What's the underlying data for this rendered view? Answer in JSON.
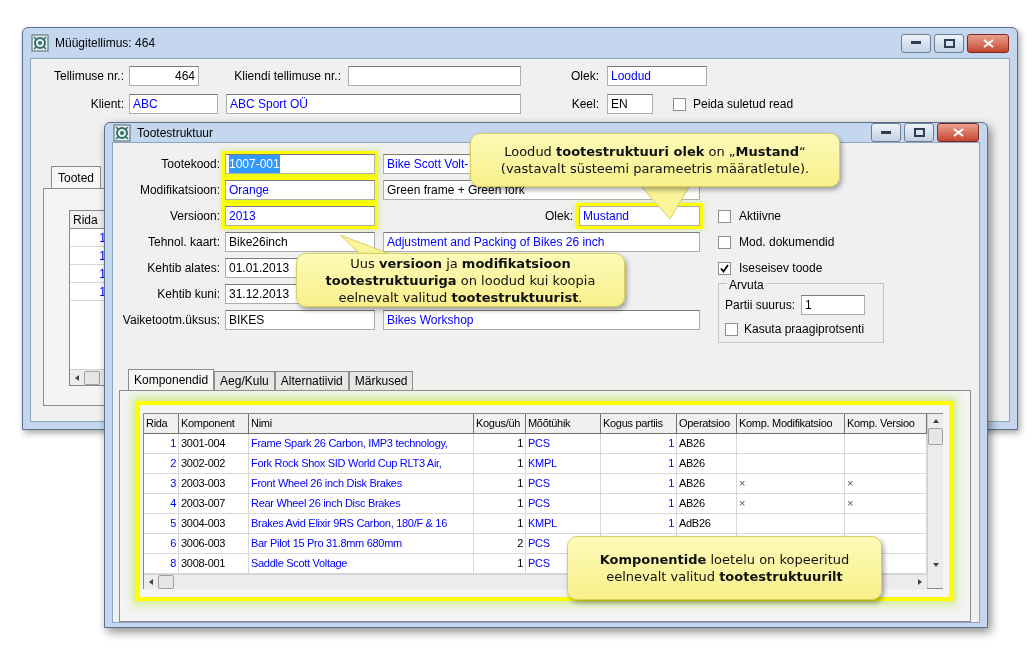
{
  "back_window": {
    "title": "Müügitellimus: 464",
    "row1": [
      {
        "label": "Tellimuse nr.:",
        "value": "464",
        "kind": "number"
      },
      {
        "label": "Kliendi tellimuse nr.:"
      },
      {
        "label": "Olek:",
        "value": "Loodud",
        "kind": "link"
      }
    ],
    "row2": [
      {
        "label": "Klient:",
        "value": "ABC",
        "kind": "link"
      },
      {
        "value": "ABC Sport OÜ",
        "kind": "link"
      },
      {
        "label": "Keel:",
        "value": "EN",
        "kind": "plain"
      }
    ],
    "checkbox": {
      "label": "Peida suletud read",
      "checked": false
    },
    "tabs": [
      {
        "label": "Tooted",
        "selected": true
      }
    ],
    "table": {
      "columns": [
        "Rida"
      ],
      "rows": [
        "1",
        "1",
        "1",
        "1"
      ]
    }
  },
  "child_window": {
    "title": "Tootestruktuur",
    "fields": [
      {
        "label": "Tootekood:",
        "value": "1007-001",
        "kind": "link",
        "highlighted": true,
        "text_selected": true,
        "description": {
          "value": "Bike Scott Volt-",
          "kind": "link"
        }
      },
      {
        "label": "Modifikatsioon:",
        "value": "Orange",
        "kind": "link",
        "highlighted": true,
        "text_selected": false,
        "description": {
          "value": "Green frame + Green fork",
          "kind": "plain"
        }
      },
      {
        "label": "Versioon:",
        "value": "2013",
        "kind": "link",
        "highlighted": true,
        "text_selected": false
      },
      {
        "label": "Tehnol. kaart:",
        "value": "Bike26inch",
        "kind": "plain",
        "highlighted": false,
        "text_selected": false,
        "description": {
          "value": "Adjustment and Packing of Bikes 26 inch",
          "kind": "link"
        }
      },
      {
        "label": "Kehtib alates:",
        "value": "01.01.2013",
        "kind": "plain",
        "highlighted": false,
        "text_selected": false
      },
      {
        "label": "Kehtib kuni:",
        "value": "31.12.2013",
        "kind": "plain",
        "highlighted": false,
        "text_selected": false
      },
      {
        "label": "Vaiketootm.üksus:",
        "value": "BIKES",
        "kind": "plain",
        "highlighted": false,
        "text_selected": false,
        "description": {
          "value": "Bikes Workshop",
          "kind": "link"
        }
      }
    ],
    "status": {
      "label": "Olek:",
      "value": "Mustand",
      "kind": "link",
      "highlighted": true
    },
    "checkboxes": [
      {
        "label": "Aktiivne",
        "checked": false
      },
      {
        "label": "Mod. dokumendid",
        "checked": false
      },
      {
        "label": "Iseseisev toode",
        "checked": true
      }
    ],
    "group": {
      "title": "Arvuta",
      "field": {
        "label": "Partii suurus:",
        "value": "1"
      },
      "checkbox": {
        "label": "Kasuta praagiprotsenti",
        "checked": false
      }
    },
    "tabs": [
      {
        "label": "Komponendid",
        "selected": true
      },
      {
        "label": "Aeg/Kulu",
        "selected": false
      },
      {
        "label": "Alternatiivid",
        "selected": false
      },
      {
        "label": "Märkused",
        "selected": false
      }
    ],
    "table": {
      "columns": [
        {
          "title": "Rida",
          "kind": "link_number"
        },
        {
          "title": "Komponent",
          "kind": "plain"
        },
        {
          "title": "Nimi",
          "kind": "link"
        },
        {
          "title": "Kogus/üh",
          "kind": "number"
        },
        {
          "title": "Mõõtühik",
          "kind": "link"
        },
        {
          "title": "Kogus partiis",
          "kind": "link_number"
        },
        {
          "title": "Operatsioo",
          "kind": "plain"
        },
        {
          "title": "Komp. Modifikatsioo",
          "kind": "mark"
        },
        {
          "title": "Komp. Versioo",
          "kind": "mark"
        }
      ],
      "rows": [
        [
          "1",
          "3001-004",
          "Frame Spark 26 Carbon, IMP3 technology,",
          "1",
          "PCS",
          "1",
          "AB26",
          null,
          null
        ],
        [
          "2",
          "3002-002",
          "Fork Rock Shox SID World Cup RLT3 Air,",
          "1",
          "KMPL",
          "1",
          "AB26",
          null,
          null
        ],
        [
          "3",
          "2003-003",
          "Front Wheel 26 inch Disk Brakes",
          "1",
          "PCS",
          "1",
          "AB26",
          "×",
          "×"
        ],
        [
          "4",
          "2003-007",
          "Rear Wheel 26 inch Disc Brakes",
          "1",
          "PCS",
          "1",
          "AB26",
          "×",
          "×"
        ],
        [
          "5",
          "3004-003",
          "Brakes Avid Elixir 9RS Carbon, 180/F & 16",
          "1",
          "KMPL",
          "1",
          "AdB26",
          null,
          null
        ],
        [
          "6",
          "3006-003",
          "Bar Pilot 15 Pro 31.8mm 680mm",
          "2",
          "PCS",
          null,
          null,
          null,
          null
        ],
        [
          "8",
          "3008-001",
          "Saddle Scott Voltage",
          "1",
          "PCS",
          null,
          null,
          null,
          null
        ]
      ]
    }
  },
  "callouts": [
    {
      "lines": [
        "Loodud **tootestruktuuri olek** on „**Mustand**“",
        "(vastavalt süsteemi parameetris määratletule)."
      ]
    },
    {
      "lines": [
        "Uus **versioon** ja **modifikatsioon**",
        "**tootestruktuuriga** on loodud kui koopia",
        "eelnevalt valitud **tootestruktuurist**."
      ]
    },
    {
      "lines": [
        "**Komponentide** loetelu on kopeeritud",
        "eelnevalt valitud **tootestruktuurilt**"
      ]
    }
  ]
}
